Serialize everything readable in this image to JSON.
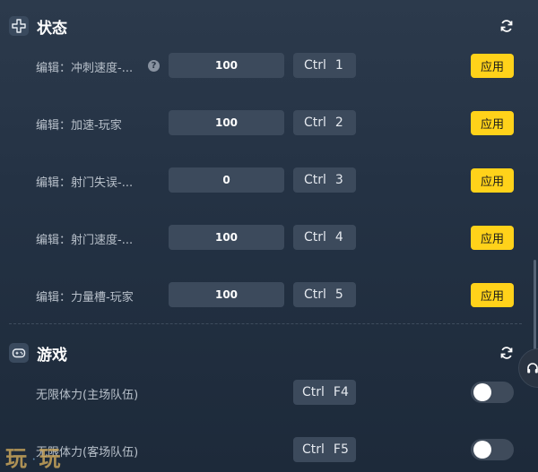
{
  "sections": {
    "status": {
      "title": "状态",
      "icon": "settings-cross-icon",
      "refresh_icon": "refresh-icon"
    },
    "game": {
      "title": "游戏",
      "icon": "gamepad-icon",
      "refresh_icon": "refresh-icon"
    }
  },
  "status_rows": [
    {
      "label": "编辑：冲刺速度-...",
      "value": "100",
      "hotkey_mod": "Ctrl",
      "hotkey_key": "1",
      "button": "应用",
      "help": "?"
    },
    {
      "label": "编辑：加速-玩家",
      "value": "100",
      "hotkey_mod": "Ctrl",
      "hotkey_key": "2",
      "button": "应用"
    },
    {
      "label": "编辑：射门失误-...",
      "value": "0",
      "hotkey_mod": "Ctrl",
      "hotkey_key": "3",
      "button": "应用"
    },
    {
      "label": "编辑：射门速度-...",
      "value": "100",
      "hotkey_mod": "Ctrl",
      "hotkey_key": "4",
      "button": "应用"
    },
    {
      "label": "编辑：力量槽-玩家",
      "value": "100",
      "hotkey_mod": "Ctrl",
      "hotkey_key": "5",
      "button": "应用"
    }
  ],
  "game_rows": [
    {
      "label": "无限体力(主场队伍)",
      "hotkey_mod": "Ctrl",
      "hotkey_key": "F4",
      "enabled": false
    },
    {
      "label": "无限体力(客场队伍)",
      "hotkey_mod": "Ctrl",
      "hotkey_key": "F5",
      "enabled": false
    }
  ],
  "watermark": {
    "left": "玩",
    "mid": "·",
    "right": "玩"
  },
  "colors": {
    "accent": "#ffd21a",
    "background": "#243244",
    "field": "#3c4a5c"
  }
}
